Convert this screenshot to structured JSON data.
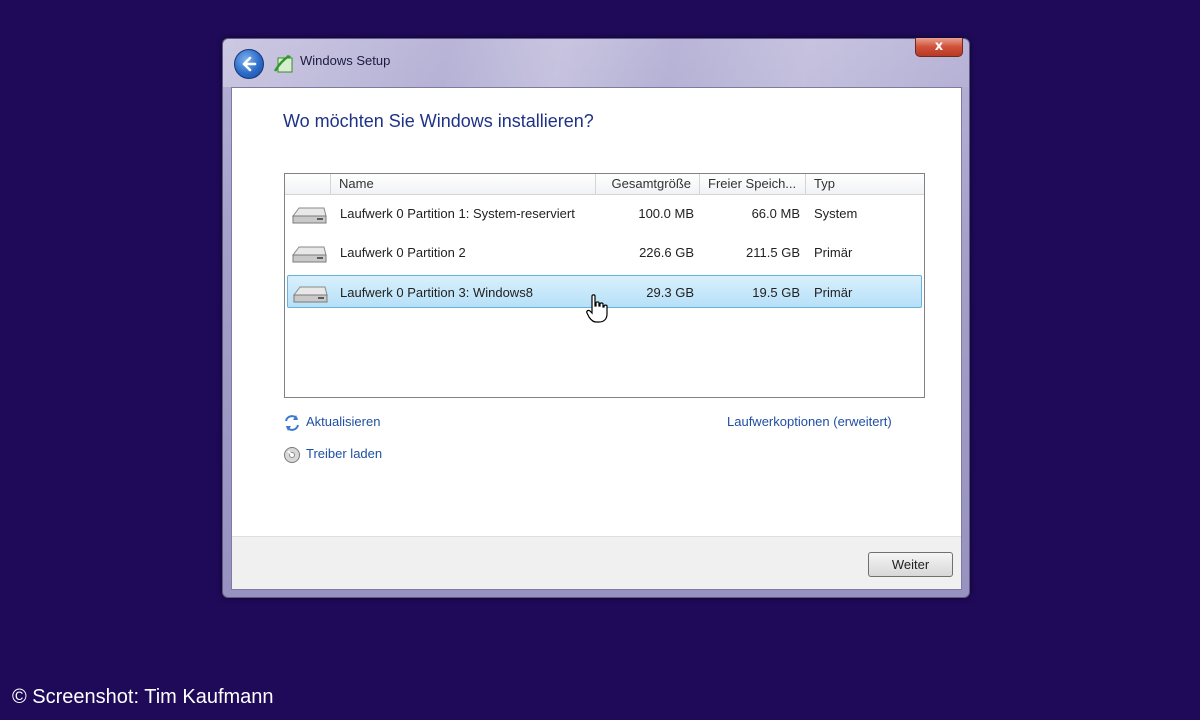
{
  "window": {
    "title": "Windows Setup",
    "close_label": "x"
  },
  "heading": "Wo möchten Sie Windows installieren?",
  "table": {
    "columns": [
      "Name",
      "Gesamtgröße",
      "Freier Speich...",
      "Typ"
    ],
    "rows": [
      {
        "name": "Laufwerk 0 Partition 1: System-reserviert",
        "total": "100.0 MB",
        "free": "66.0 MB",
        "type": "System",
        "selected": false
      },
      {
        "name": "Laufwerk 0 Partition 2",
        "total": "226.6 GB",
        "free": "211.5 GB",
        "type": "Primär",
        "selected": false
      },
      {
        "name": "Laufwerk 0 Partition 3: Windows8",
        "total": "29.3 GB",
        "free": "19.5 GB",
        "type": "Primär",
        "selected": true
      }
    ]
  },
  "links": {
    "refresh": "Aktualisieren",
    "load_driver": "Treiber laden",
    "drive_options": "Laufwerkoptionen (erweitert)"
  },
  "buttons": {
    "next": "Weiter"
  },
  "credit": "© Screenshot: Tim Kaufmann",
  "colors": {
    "background": "#1f0a59",
    "heading": "#1e3287",
    "link": "#1f4fa3",
    "selection": "#b6e0f8"
  },
  "icons": [
    "back-arrow-icon",
    "setup-icon",
    "close-icon",
    "drive-icon",
    "refresh-icon",
    "load-driver-icon",
    "hand-cursor-icon"
  ]
}
